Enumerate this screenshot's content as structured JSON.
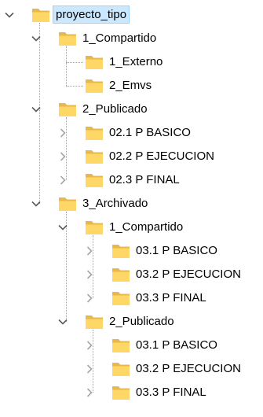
{
  "tree": {
    "nodes": [
      {
        "label": "proyecto_tipo",
        "depth": 0,
        "state": "expanded",
        "selected": true
      },
      {
        "label": "1_Compartido",
        "depth": 1,
        "state": "expanded"
      },
      {
        "label": "1_Externo",
        "depth": 2,
        "state": "leaf"
      },
      {
        "label": "2_Emvs",
        "depth": 2,
        "state": "leaf"
      },
      {
        "label": "2_Publicado",
        "depth": 1,
        "state": "expanded"
      },
      {
        "label": "02.1 P BASICO",
        "depth": 2,
        "state": "collapsed"
      },
      {
        "label": "02.2 P EJECUCION",
        "depth": 2,
        "state": "collapsed"
      },
      {
        "label": "02.3 P FINAL",
        "depth": 2,
        "state": "collapsed"
      },
      {
        "label": "3_Archivado",
        "depth": 1,
        "state": "expanded"
      },
      {
        "label": "1_Compartido",
        "depth": 2,
        "state": "expanded"
      },
      {
        "label": "03.1 P BASICO",
        "depth": 3,
        "state": "collapsed"
      },
      {
        "label": "03.2 P EJECUCION",
        "depth": 3,
        "state": "collapsed"
      },
      {
        "label": "03.3 P FINAL",
        "depth": 3,
        "state": "collapsed"
      },
      {
        "label": "2_Publicado",
        "depth": 2,
        "state": "expanded"
      },
      {
        "label": "03.1 P BASICO",
        "depth": 3,
        "state": "collapsed"
      },
      {
        "label": "03.2 P EJECUCION",
        "depth": 3,
        "state": "collapsed"
      },
      {
        "label": "03.3 P FINAL",
        "depth": 3,
        "state": "collapsed"
      }
    ]
  },
  "colors": {
    "folder_back": "#e8b94a",
    "folder_front": "#ffd766",
    "chevron": "#5a5a5a",
    "chevron_collapsed": "#a6a6a6",
    "selection": "#cce8ff"
  }
}
